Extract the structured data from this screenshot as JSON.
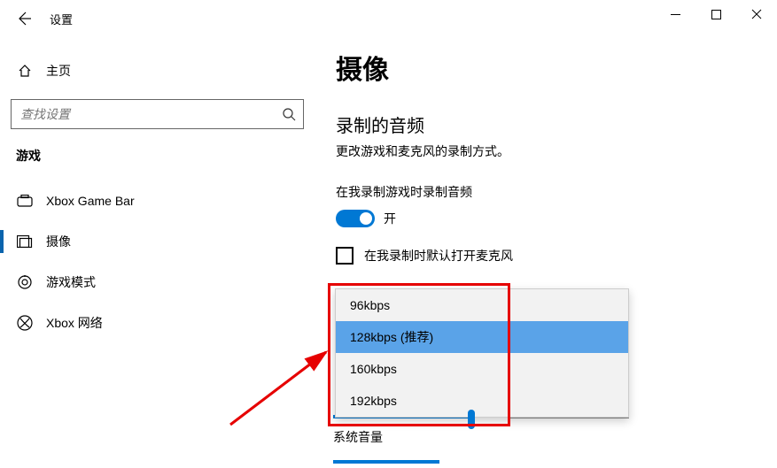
{
  "app_title": "设置",
  "home_label": "主页",
  "search_placeholder": "查找设置",
  "section_header": "游戏",
  "nav": [
    {
      "label": "Xbox Game Bar"
    },
    {
      "label": "摄像"
    },
    {
      "label": "游戏模式"
    },
    {
      "label": "Xbox 网络"
    }
  ],
  "page_title": "摄像",
  "sub_title": "录制的音频",
  "sub_desc": "更改游戏和麦克风的录制方式。",
  "toggle_caption": "在我录制游戏时录制音频",
  "toggle_state": "开",
  "checkbox_label": "在我录制时默认打开麦克风",
  "dropdown_options": [
    "96kbps",
    "128kbps (推荐)",
    "160kbps",
    "192kbps"
  ],
  "dropdown_selected_index": 1,
  "below_label": "系统音量"
}
